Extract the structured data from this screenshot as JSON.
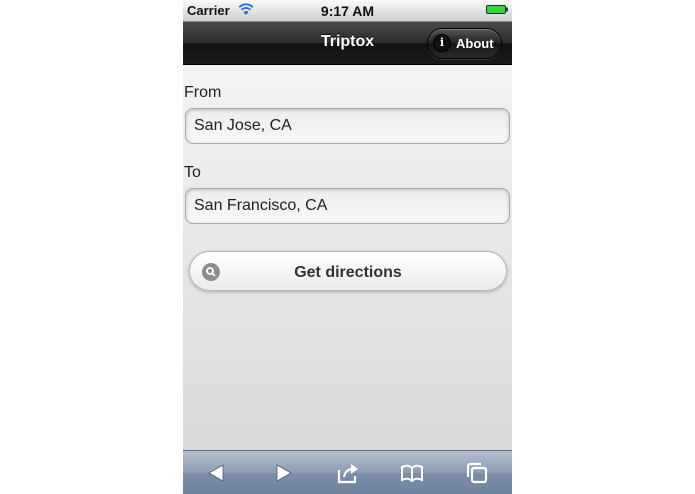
{
  "status_bar": {
    "carrier": "Carrier",
    "time": "9:17 AM",
    "wifi_icon": "wifi-icon",
    "battery_icon": "battery-icon"
  },
  "header": {
    "title": "Triptox",
    "about_button": {
      "label": "About",
      "icon": "info-icon"
    }
  },
  "form": {
    "from_label": "From",
    "from_value": "San Jose, CA",
    "to_label": "To",
    "to_value": "San Francisco, CA",
    "submit_label": "Get directions",
    "submit_icon": "search-icon"
  },
  "toolbar": {
    "items": [
      "back-icon",
      "forward-icon",
      "share-icon",
      "bookmarks-icon",
      "tabs-icon"
    ]
  },
  "colors": {
    "header_bg": "#1a1a1a",
    "toolbar_bg": "#7d8fa8",
    "battery": "#3cd23c"
  }
}
